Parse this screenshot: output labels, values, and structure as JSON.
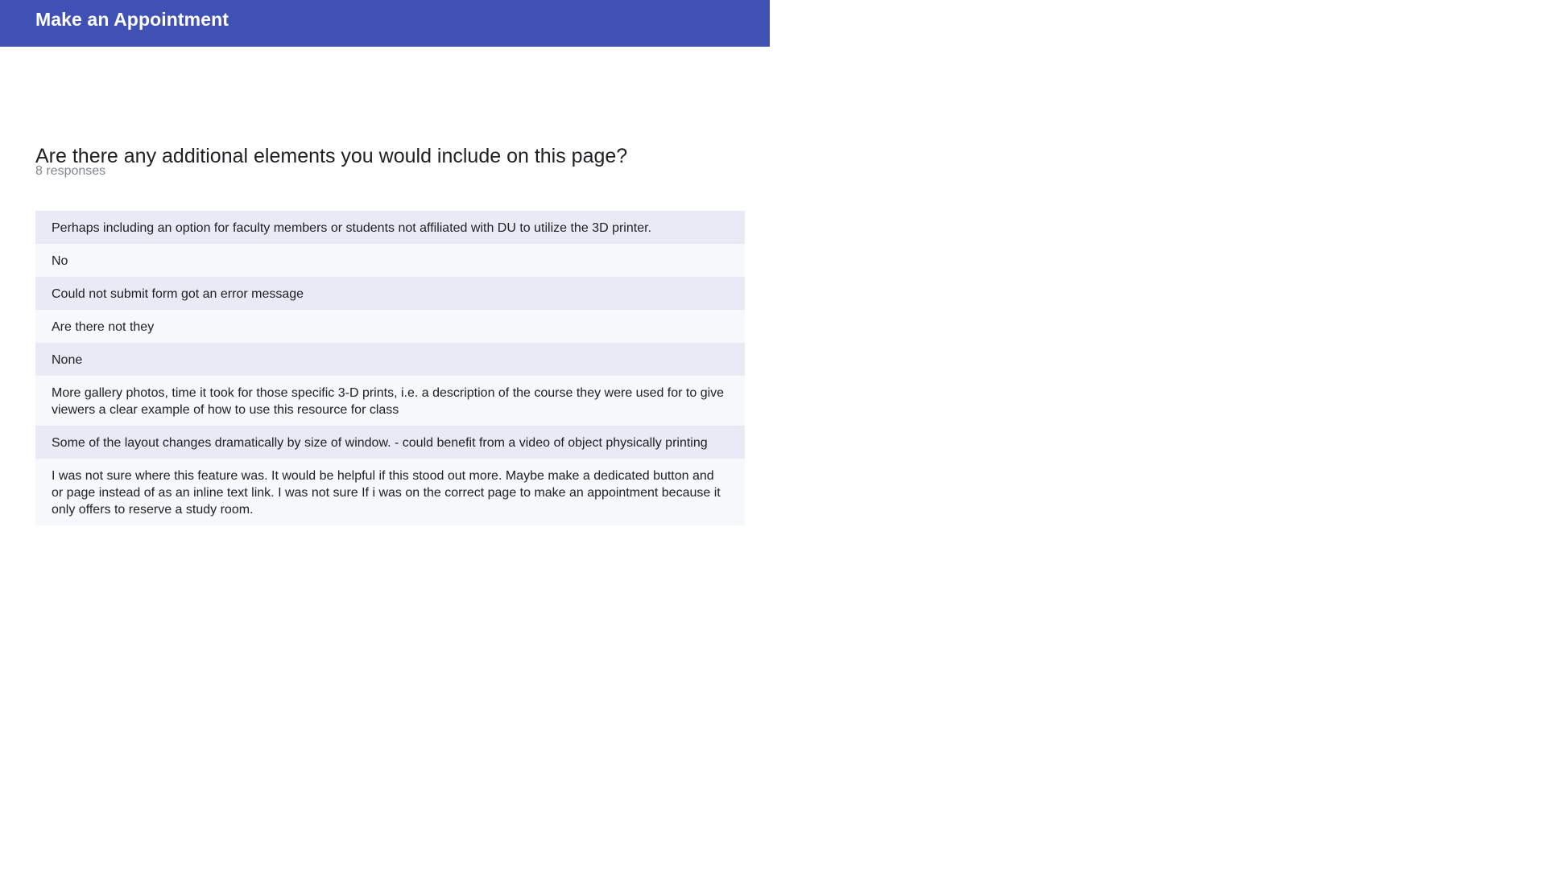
{
  "header": {
    "title": "Make an Appointment",
    "background_color": "#3f51b5"
  },
  "question": {
    "title": "Are there any additional elements you would include on this page?",
    "response_count": "8 responses"
  },
  "responses": [
    "Perhaps including an option for faculty members or students not affiliated with DU to utilize the 3D printer.",
    "No",
    "Could not submit form got an error message",
    "Are there not they",
    "None",
    "More gallery photos, time it took for those specific 3-D prints, i.e. a description of the course they were used for to give viewers a clear example of how to use this resource for class",
    "Some of the layout changes dramatically by size of window. - could benefit from a video of object physically printing",
    "I was not sure where this feature was. It would be helpful if this stood out more. Maybe make a dedicated button and or page instead of as an inline text link. I was not sure If i was on the correct page to make an appointment because it only offers to reserve a study room."
  ],
  "colors": {
    "row_odd": "#e8eaf6",
    "row_even": "#f7f8fc",
    "text": "#202124",
    "muted_text": "#80868b"
  }
}
